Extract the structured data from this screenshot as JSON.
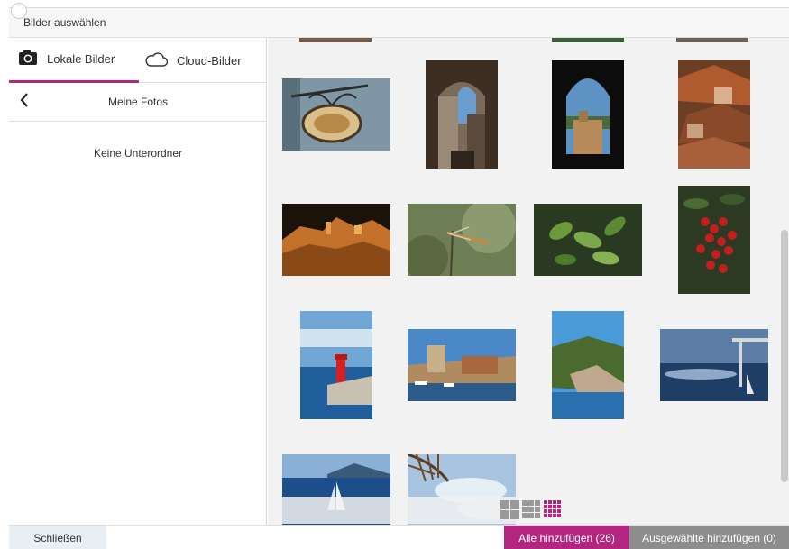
{
  "window": {
    "title": "Bilder auswählen"
  },
  "tabs": [
    {
      "label": "Lokale Bilder",
      "icon": "camera-icon",
      "active": true
    },
    {
      "label": "Cloud-Bilder",
      "icon": "cloud-icon",
      "active": false
    }
  ],
  "folder": {
    "title": "Meine Fotos",
    "back_icon": "chevron-left-icon",
    "empty_message": "Keine Unterordner"
  },
  "view_modes": [
    "large-grid",
    "medium-grid",
    "small-grid"
  ],
  "active_view_mode": "small-grid",
  "footer": {
    "close_label": "Schließen",
    "add_all_label": "Alle hinzufügen (26)",
    "add_selected_label": "Ausgewählte hinzufügen (0)"
  },
  "colors": {
    "accent": "#b3267f",
    "secondary_button": "#8d8d8d",
    "close_button": "#e7eff4"
  },
  "photos": [
    "Hanging shop sign",
    "Old town alley through archway",
    "Fortress seen through window arch",
    "Terracotta rooftops",
    "Illuminated hilltop village at night",
    "Dragonfly on stem",
    "Green leaves",
    "Red berries",
    "Red lighthouse",
    "Harbour with fortress tower",
    "Coastal cliffs",
    "Sea view from terrace",
    "Sailboat at sea",
    "Palm fronds and sky"
  ]
}
